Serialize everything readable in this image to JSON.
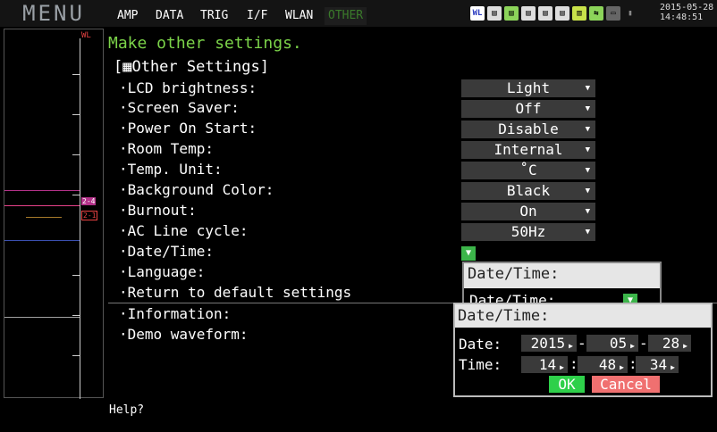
{
  "header": {
    "menu_label": "MENU",
    "tabs": [
      "AMP",
      "DATA",
      "TRIG",
      "I/F",
      "WLAN",
      "OTHER"
    ],
    "active_tab": "OTHER",
    "date": "2015-05-28",
    "time": "14:48:51"
  },
  "waveform": {
    "top_label": "WL",
    "marker_a": "2-4",
    "marker_b": "2-1",
    "colors": [
      "#b4328a",
      "#e8428a",
      "#a77a2a",
      "#3a4fb0",
      "#a0a0a0"
    ]
  },
  "panel": {
    "subtitle": "Make other settings.",
    "section_title": "[▦Other Settings]",
    "rows": [
      {
        "label": "·LCD brightness:",
        "value": "Light"
      },
      {
        "label": "·Screen Saver:",
        "value": "Off"
      },
      {
        "label": "·Power On Start:",
        "value": "Disable"
      },
      {
        "label": "·Room Temp:",
        "value": "Internal"
      },
      {
        "label": "·Temp. Unit:",
        "value": "˚C"
      },
      {
        "label": "·Background Color:",
        "value": "Black"
      },
      {
        "label": "·Burnout:",
        "value": "On"
      },
      {
        "label": "·AC Line cycle:",
        "value": "50Hz"
      },
      {
        "label": "·Date/Time:",
        "value": ""
      },
      {
        "label": "·Language:",
        "value": ""
      },
      {
        "label": "·Return to default settings",
        "value": ""
      },
      {
        "label": "·Information:",
        "value": ""
      },
      {
        "label": "·Demo waveform:",
        "value": ""
      }
    ]
  },
  "popup_back": {
    "title": "Date/Time:",
    "row_label": "Date/Time:"
  },
  "popup": {
    "title": "Date/Time:",
    "date_label": "Date:",
    "time_label": "Time:",
    "year": "2015",
    "month": "05",
    "day": "28",
    "hour": "14",
    "minute": "48",
    "second": "34",
    "ok_label": "OK",
    "cancel_label": "Cancel"
  },
  "footer": {
    "help": "Help?"
  }
}
